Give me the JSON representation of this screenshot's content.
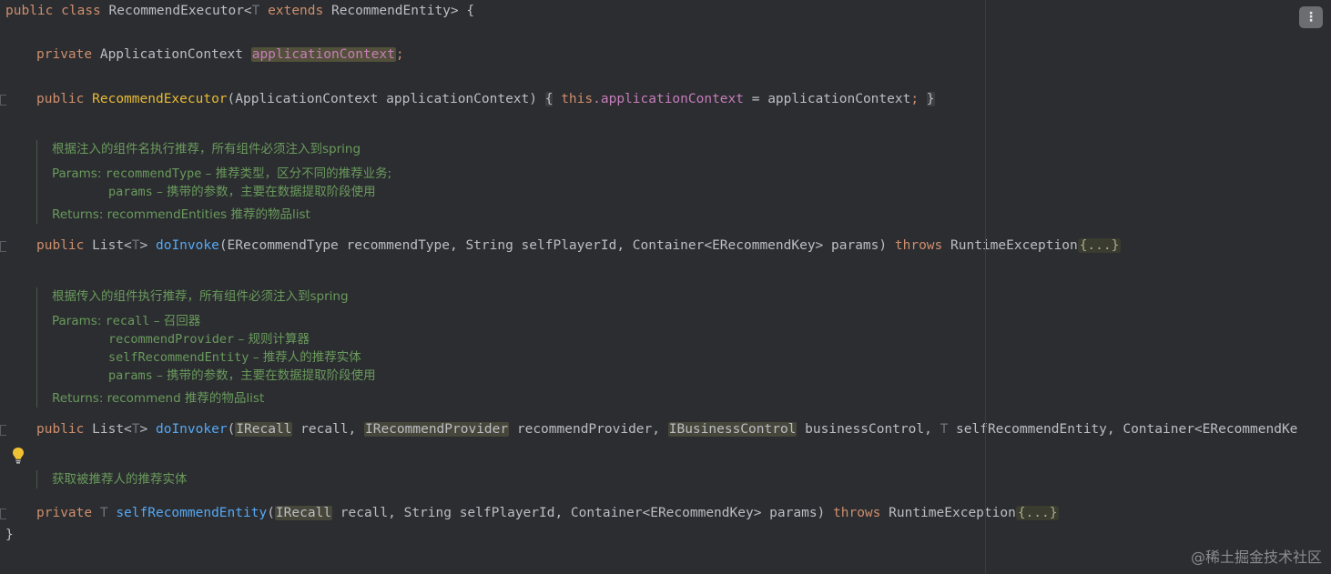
{
  "code": {
    "class_decl": {
      "kw_public": "public",
      "kw_class": "class",
      "name": "RecommendExecutor<",
      "type_param": "T",
      "kw_extends": "extends",
      "rest": "RecommendEntity> {"
    },
    "field_decl": {
      "kw_private": "private",
      "type": "ApplicationContext",
      "name": "applicationContext",
      "semicolon": ";"
    },
    "ctor": {
      "kw_public": "public",
      "name": "RecommendExecutor",
      "params": "(ApplicationContext applicationContext)",
      "open": "{",
      "kw_this": "this",
      "dot_field": ".applicationContext",
      "assign": " = applicationContext",
      "semicolon": ";",
      "close": "}"
    },
    "doc1": {
      "summary": "根据注入的组件名执行推荐，所有组件必须注入到spring",
      "params_label": "Params:",
      "p1_name": "recommendType",
      "p1_desc": " – 推荐类型，区分不同的推荐业务;",
      "p2_name": "params",
      "p2_desc": " – 携带的参数，主要在数据提取阶段使用",
      "returns": "Returns: recommendEntities 推荐的物品list"
    },
    "m1": {
      "kw_public": "public",
      "ret": "List<",
      "tp": "T",
      "ret_close": ">",
      "name": "doInvoke",
      "params": "(ERecommendType recommendType, String selfPlayerId, Container<ERecommendKey> params)",
      "kw_throws": "throws",
      "exc": "RuntimeException",
      "fold": "{...}"
    },
    "doc2": {
      "summary": "根据传入的组件执行推荐，所有组件必须注入到spring",
      "params_label": "Params:",
      "p1_name": "recall",
      "p1_desc": " – 召回器",
      "p2_name": "recommendProvider",
      "p2_desc": " – 规则计算器",
      "p3_name": "selfRecommendEntity",
      "p3_desc": " – 推荐人的推荐实体",
      "p4_name": "params",
      "p4_desc": " – 携带的参数，主要在数据提取阶段使用",
      "returns": "Returns: recommend 推荐的物品list"
    },
    "m2": {
      "kw_public": "public",
      "ret": "List<",
      "tp": "T",
      "ret_close": ">",
      "name": "doInvoker",
      "open": "(",
      "t1": "IRecall",
      "a1": " recall, ",
      "t2": "IRecommendProvider",
      "a2": " recommendProvider, ",
      "t3": "IBusinessControl",
      "a3": " businessControl, ",
      "tp2": "T",
      "a4": " selfRecommendEntity, Container<ERecommendKe"
    },
    "doc3": {
      "summary": "获取被推荐人的推荐实体"
    },
    "m3": {
      "kw_private": "private",
      "tp": "T",
      "name": "selfRecommendEntity",
      "open": "(",
      "t1": "IRecall",
      "rest": " recall, String selfPlayerId, Container<ERecommendKey> params)",
      "kw_throws": "throws",
      "exc": "RuntimeException",
      "fold": "{...}"
    },
    "class_close": "}"
  },
  "ui": {
    "menu_glyph": "⋮",
    "watermark": "@稀土掘金技术社区",
    "bulb_icon": "lightbulb-icon"
  }
}
